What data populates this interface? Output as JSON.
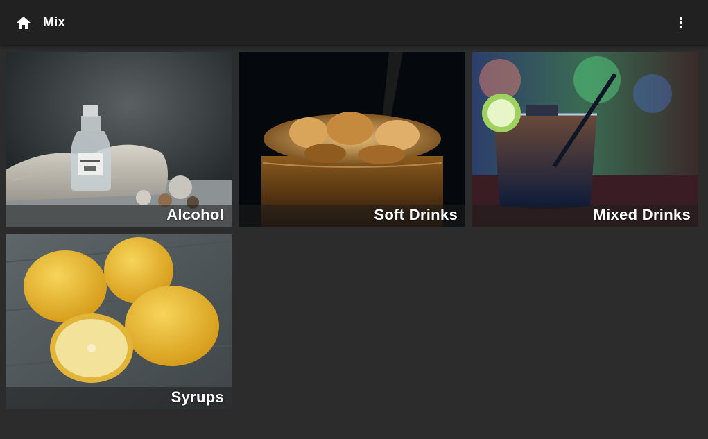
{
  "appbar": {
    "title": "Mix",
    "home_icon": "home-icon",
    "menu_icon": "more-vert-icon"
  },
  "categories": [
    {
      "label": "Alcohol",
      "image": "gin bottle with pine cones"
    },
    {
      "label": "Soft Drinks",
      "image": "glass of cola with ice"
    },
    {
      "label": "Mixed Drinks",
      "image": "cocktail with lime and straw"
    },
    {
      "label": "Syrups",
      "image": "lemons on wooden table"
    }
  ],
  "colors": {
    "background": "#2c2c2c",
    "appbar": "#212121",
    "text": "#ffffff"
  }
}
